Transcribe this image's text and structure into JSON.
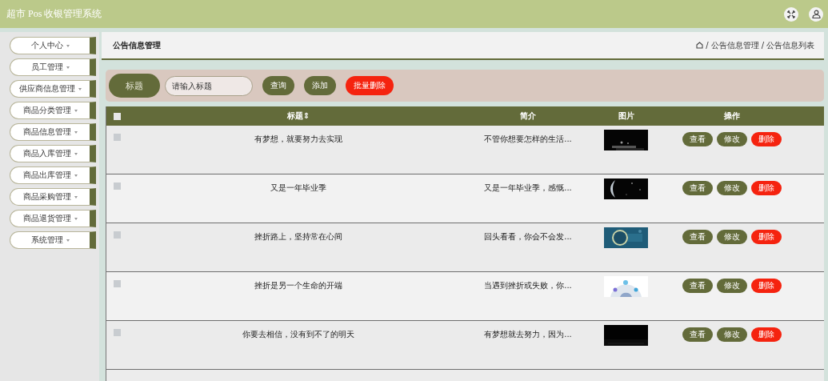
{
  "header": {
    "title": "超市 Pos 收银管理系统"
  },
  "sidebar": {
    "items": [
      {
        "label": "个人中心"
      },
      {
        "label": "员工管理"
      },
      {
        "label": "供应商信息管理"
      },
      {
        "label": "商品分类管理"
      },
      {
        "label": "商品信息管理"
      },
      {
        "label": "商品入库管理"
      },
      {
        "label": "商品出库管理"
      },
      {
        "label": "商品采购管理"
      },
      {
        "label": "商品退货管理"
      },
      {
        "label": "系统管理"
      }
    ]
  },
  "page_title": "公告信息管理",
  "breadcrumb": [
    "公告信息管理",
    "公告信息列表"
  ],
  "breadcrumb_separator": "/",
  "search": {
    "label": "标题",
    "placeholder": "请输入标题",
    "buttons": [
      {
        "label": "查询",
        "kind": "primary"
      },
      {
        "label": "添加",
        "kind": "primary"
      },
      {
        "label": "批量删除",
        "kind": "danger"
      }
    ]
  },
  "table": {
    "columns": [
      "标题⇕",
      "简介",
      "图片",
      "操作"
    ],
    "header_checked": false,
    "rows": [
      {
        "checked": false,
        "title": "有梦想，就要努力去实现",
        "summary": "不管你想要怎样的生活...",
        "picture": {
          "kind": "picture"
        },
        "actions": [
          "查看",
          "修改",
          "删除"
        ]
      },
      {
        "checked": false,
        "title": "又是一年毕业季",
        "summary": "又是一年毕业季，感慨...",
        "picture": {
          "kind": "picture"
        },
        "actions": [
          "查看",
          "修改",
          "删除"
        ]
      },
      {
        "checked": false,
        "title": "挫折路上，坚持常在心间",
        "summary": "回头看看，你会不会发...",
        "picture": {
          "kind": "picture"
        },
        "actions": [
          "查看",
          "修改",
          "删除"
        ]
      },
      {
        "checked": false,
        "title": "挫折是另一个生命的开端",
        "summary": "当遇到挫折或失败，你...",
        "picture": {
          "kind": "picture"
        },
        "actions": [
          "查看",
          "修改",
          "删除"
        ]
      },
      {
        "checked": false,
        "title": "你要去相信，没有到不了的明天",
        "summary": "有梦想就去努力，因为...",
        "picture": {
          "kind": "picture"
        },
        "actions": [
          "查看",
          "修改",
          "删除"
        ]
      }
    ]
  }
}
